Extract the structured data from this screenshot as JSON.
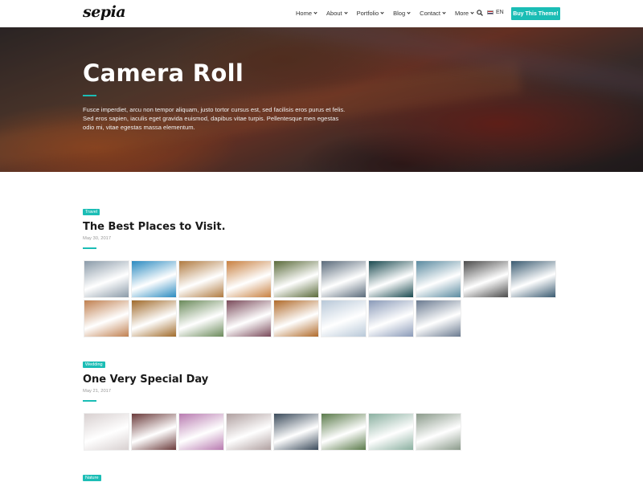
{
  "header": {
    "logo": "sepia",
    "nav": [
      {
        "label": "Home",
        "dropdown": true
      },
      {
        "label": "About",
        "dropdown": true
      },
      {
        "label": "Portfolio",
        "dropdown": true
      },
      {
        "label": "Blog",
        "dropdown": true
      },
      {
        "label": "Contact",
        "dropdown": true
      },
      {
        "label": "More",
        "dropdown": true
      }
    ],
    "search_icon": "search-icon",
    "language": "EN",
    "buy_button": "Buy This Theme!"
  },
  "hero": {
    "title": "Camera Roll",
    "text": "Fusce imperdiet, arcu non tempor aliquam, justo tortor cursus est, sed facilisis eros purus et felis. Sed eros sapien, iaculis eget gravida euismod, dapibus vitae turpis. Pellentesque men egestas odio mi, vitae egestas massa elementum."
  },
  "posts": [
    {
      "tag": "Travel",
      "title": "The Best Places to Visit.",
      "date": "May 30, 2017",
      "thumbs": [
        "#8a9aa8",
        "#2a8ac0",
        "#b07a40",
        "#c88040",
        "#5a6a3a",
        "#5a6a7a",
        "#1a4a50",
        "#5a8aa0",
        "#4a4a4a",
        "#3a5a70",
        "#c08050",
        "#a06a2a",
        "#6a8a5a",
        "#7a4a5a",
        "#b06a2a",
        "#b8c8d8",
        "#8a9ab8",
        "#6a7a90"
      ]
    },
    {
      "tag": "Wedding",
      "title": "One Very Special Day",
      "date": "May 21, 2017",
      "thumbs": [
        "#d8d0d0",
        "#6a3a3a",
        "#b87ab0",
        "#b0a0a0",
        "#3a4a5a",
        "#5a7a4a",
        "#8ab0a0",
        "#8a9a8a"
      ]
    },
    {
      "tag": "Nature",
      "title": "",
      "date": "",
      "thumbs": []
    }
  ],
  "colors": {
    "accent": "#1bbdb5",
    "text": "#1a1a1a"
  }
}
